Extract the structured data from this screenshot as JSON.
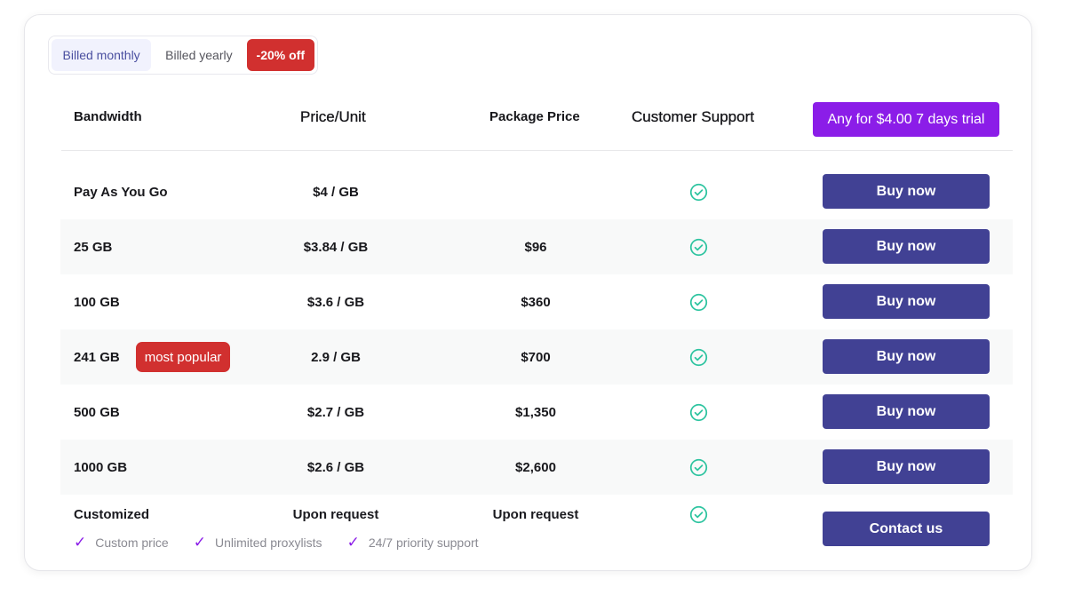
{
  "billing_toggle": {
    "monthly_label": "Billed monthly",
    "yearly_label": "Billed yearly",
    "discount_label": "-20% off",
    "selected": "monthly"
  },
  "header": {
    "bandwidth": "Bandwidth",
    "price_unit": "Price/Unit",
    "package_price": "Package Price",
    "customer_support": "Customer Support",
    "trial_button": "Any for $4.00 7 days trial"
  },
  "rows": [
    {
      "bandwidth": "Pay As You Go",
      "price_unit": "$4 / GB",
      "package_price": "",
      "support": true,
      "badge": "",
      "button": "Buy now"
    },
    {
      "bandwidth": "25 GB",
      "price_unit": "$3.84 / GB",
      "package_price": "$96",
      "support": true,
      "badge": "",
      "button": "Buy now"
    },
    {
      "bandwidth": "100 GB",
      "price_unit": "$3.6 / GB",
      "package_price": "$360",
      "support": true,
      "badge": "",
      "button": "Buy now"
    },
    {
      "bandwidth": "241 GB",
      "price_unit": "2.9 / GB",
      "package_price": "$700",
      "support": true,
      "badge": "most popular",
      "button": "Buy now"
    },
    {
      "bandwidth": "500 GB",
      "price_unit": "$2.7 / GB",
      "package_price": "$1,350",
      "support": true,
      "badge": "",
      "button": "Buy now"
    },
    {
      "bandwidth": "1000 GB",
      "price_unit": "$2.6 / GB",
      "package_price": "$2,600",
      "support": true,
      "badge": "",
      "button": "Buy now"
    }
  ],
  "customized": {
    "title": "Customized",
    "price_unit": "Upon request",
    "package_price": "Upon request",
    "support": true,
    "features": [
      "Custom price",
      "Unlimited proxylists",
      "24/7 priority support"
    ],
    "button": "Contact us"
  },
  "colors": {
    "accent_purple": "#8b1de8",
    "button_indigo": "#414194",
    "badge_red": "#d1302f",
    "check_teal": "#2ec4a0"
  }
}
